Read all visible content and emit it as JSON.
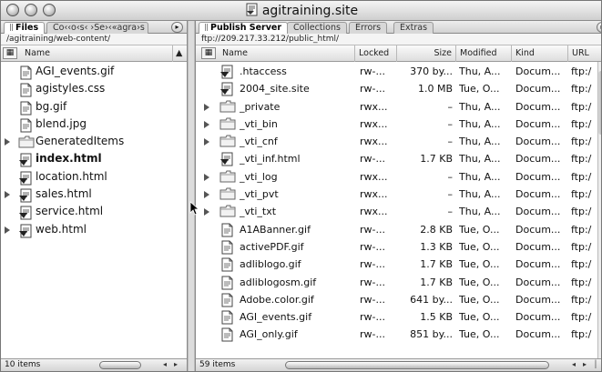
{
  "window": {
    "title": "agitraining.site"
  },
  "left_panel": {
    "tabs": [
      {
        "label": "Files",
        "active": true
      },
      {
        "label": "Co‹‹o‹s‹ ›Se›‹«agra›s",
        "active": false
      }
    ],
    "path": "/agitraining/web-content/",
    "column": "Name",
    "files": [
      {
        "name": "AGI_events.gif",
        "icon": "gif-file-icon",
        "expandable": false,
        "selected": false
      },
      {
        "name": "agistyles.css",
        "icon": "css-file-icon",
        "expandable": false,
        "selected": false
      },
      {
        "name": "bg.gif",
        "icon": "gif-file-icon",
        "expandable": false,
        "selected": false
      },
      {
        "name": "blend.jpg",
        "icon": "jpg-file-icon",
        "expandable": false,
        "selected": false
      },
      {
        "name": "GeneratedItems",
        "icon": "folder-icon",
        "expandable": true,
        "selected": false
      },
      {
        "name": "index.html",
        "icon": "html-file-icon",
        "expandable": false,
        "selected": true
      },
      {
        "name": "location.html",
        "icon": "html-file-icon",
        "expandable": false,
        "selected": false
      },
      {
        "name": "sales.html",
        "icon": "html-file-icon",
        "expandable": true,
        "selected": false
      },
      {
        "name": "service.html",
        "icon": "html-file-icon",
        "expandable": false,
        "selected": false
      },
      {
        "name": "web.html",
        "icon": "html-file-icon",
        "expandable": true,
        "selected": false
      }
    ],
    "status": "10 items"
  },
  "right_panel": {
    "tabs": [
      {
        "label": "Publish Server",
        "active": true
      },
      {
        "label": "Collections",
        "active": false
      },
      {
        "label": "Errors",
        "active": false
      },
      {
        "label": "Extras",
        "active": false
      }
    ],
    "path": "ftp://209.217.33.212/public_html/",
    "columns": {
      "name": "Name",
      "locked": "Locked",
      "size": "Size",
      "modified": "Modified",
      "kind": "Kind",
      "url": "URL"
    },
    "files": [
      {
        "name": ".htaccess",
        "icon": "html-file-icon",
        "expandable": false,
        "locked": "rw-...",
        "size": "370 by...",
        "modified": "Thu, A...",
        "kind": "Docum...",
        "url": "ftp:/"
      },
      {
        "name": "2004_site.site",
        "icon": "html-file-icon",
        "expandable": false,
        "locked": "rw-...",
        "size": "1.0 MB",
        "modified": "Tue, O...",
        "kind": "Docum...",
        "url": "ftp:/"
      },
      {
        "name": "_private",
        "icon": "folder-icon",
        "expandable": true,
        "locked": "rwx...",
        "size": "–",
        "modified": "Thu, A...",
        "kind": "Docum...",
        "url": "ftp:/"
      },
      {
        "name": "_vti_bin",
        "icon": "folder-icon",
        "expandable": true,
        "locked": "rwx...",
        "size": "–",
        "modified": "Thu, A...",
        "kind": "Docum...",
        "url": "ftp:/"
      },
      {
        "name": "_vti_cnf",
        "icon": "folder-icon",
        "expandable": true,
        "locked": "rwx...",
        "size": "–",
        "modified": "Thu, A...",
        "kind": "Docum...",
        "url": "ftp:/"
      },
      {
        "name": "_vti_inf.html",
        "icon": "html-file-icon",
        "expandable": false,
        "locked": "rw-...",
        "size": "1.7 KB",
        "modified": "Thu, A...",
        "kind": "Docum...",
        "url": "ftp:/"
      },
      {
        "name": "_vti_log",
        "icon": "folder-icon",
        "expandable": true,
        "locked": "rwx...",
        "size": "–",
        "modified": "Thu, A...",
        "kind": "Docum...",
        "url": "ftp:/"
      },
      {
        "name": "_vti_pvt",
        "icon": "folder-icon",
        "expandable": true,
        "locked": "rwx...",
        "size": "–",
        "modified": "Thu, A...",
        "kind": "Docum...",
        "url": "ftp:/"
      },
      {
        "name": "_vti_txt",
        "icon": "folder-icon",
        "expandable": true,
        "locked": "rwx...",
        "size": "–",
        "modified": "Thu, A...",
        "kind": "Docum...",
        "url": "ftp:/"
      },
      {
        "name": "A1ABanner.gif",
        "icon": "gif-file-icon",
        "expandable": false,
        "locked": "rw-...",
        "size": "2.8 KB",
        "modified": "Tue, O...",
        "kind": "Docum...",
        "url": "ftp:/"
      },
      {
        "name": "activePDF.gif",
        "icon": "gif-file-icon",
        "expandable": false,
        "locked": "rw-...",
        "size": "1.3 KB",
        "modified": "Tue, O...",
        "kind": "Docum...",
        "url": "ftp:/"
      },
      {
        "name": "adliblogo.gif",
        "icon": "gif-file-icon",
        "expandable": false,
        "locked": "rw-...",
        "size": "1.7 KB",
        "modified": "Tue, O...",
        "kind": "Docum...",
        "url": "ftp:/"
      },
      {
        "name": "adliblogosm.gif",
        "icon": "gif-file-icon",
        "expandable": false,
        "locked": "rw-...",
        "size": "1.7 KB",
        "modified": "Tue, O...",
        "kind": "Docum...",
        "url": "ftp:/"
      },
      {
        "name": "Adobe.color.gif",
        "icon": "gif-file-icon",
        "expandable": false,
        "locked": "rw-...",
        "size": "641 by...",
        "modified": "Tue, O...",
        "kind": "Docum...",
        "url": "ftp:/"
      },
      {
        "name": "AGI_events.gif",
        "icon": "gif-file-icon",
        "expandable": false,
        "locked": "rw-...",
        "size": "1.5 KB",
        "modified": "Tue, O...",
        "kind": "Docum...",
        "url": "ftp:/"
      },
      {
        "name": "AGI_only.gif",
        "icon": "gif-file-icon",
        "expandable": false,
        "locked": "rw-...",
        "size": "851 by...",
        "modified": "Tue, O...",
        "kind": "Docum...",
        "url": "ftp:/"
      }
    ],
    "status": "59 items"
  }
}
